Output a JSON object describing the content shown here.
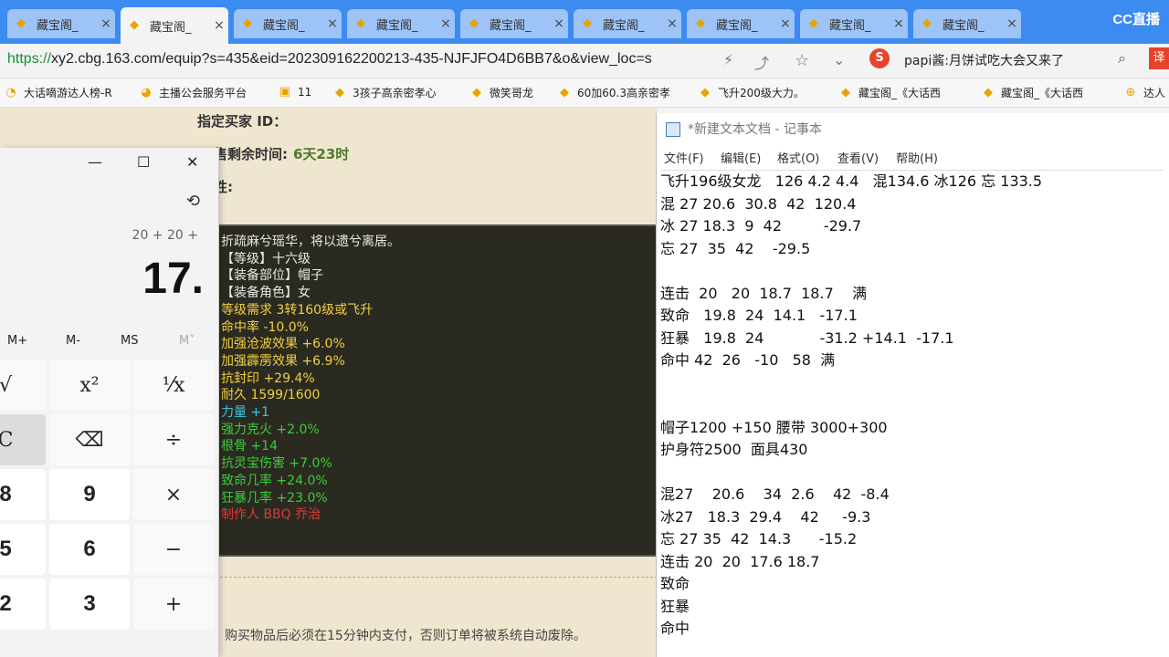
{
  "tabs": [
    {
      "label": "藏宝阁_"
    },
    {
      "label": "藏宝阁_"
    },
    {
      "label": "藏宝阁_"
    },
    {
      "label": "藏宝阁_"
    },
    {
      "label": "藏宝阁_"
    },
    {
      "label": "藏宝阁_"
    },
    {
      "label": "藏宝阁_"
    },
    {
      "label": "藏宝阁_"
    },
    {
      "label": "藏宝阁_"
    }
  ],
  "tab_close": "×",
  "cc_logo": "CC直播",
  "address": {
    "scheme": "https://",
    "rest": "xy2.cbg.163.com/equip?s=435&eid=202309162200213-435-NJFJFO4D6BB7&o&view_loc=s",
    "search_badge": "S",
    "search_text": "papi酱:月饼试吃大会又来了"
  },
  "bookmarks": [
    {
      "label": "大话嘀游达人榜-R"
    },
    {
      "label": "主播公会服务平台"
    },
    {
      "label": "11"
    },
    {
      "label": "3孩子高亲密孝心"
    },
    {
      "label": "微笑哥龙"
    },
    {
      "label": "60加60.3高亲密孝"
    },
    {
      "label": "飞升200级大力。"
    },
    {
      "label": "藏宝阁_《大话西"
    },
    {
      "label": "藏宝阁_《大话西"
    },
    {
      "label": "达人"
    }
  ],
  "page": {
    "buyer_id_label": "指定买家 ID：",
    "time_left_label": "售剩余时间:",
    "time_left_value": "6天23时",
    "other_label": "性:",
    "item_lines": [
      {
        "text": "折疏麻兮瑶华，将以遗兮离居。",
        "color": "#e8e8e8"
      },
      {
        "text": "【等级】十六级",
        "color": "#e8e8e8"
      },
      {
        "text": "【装备部位】帽子",
        "color": "#e8e8e8"
      },
      {
        "text": "【装备角色】女",
        "color": "#e8e8e8"
      },
      {
        "text": "等级需求 3转160级或飞升",
        "color": "#f0d040"
      },
      {
        "text": "命中率 -10.0%",
        "color": "#f0d040"
      },
      {
        "text": "加强沧波效果 +6.0%",
        "color": "#f0d040"
      },
      {
        "text": "加强霹雳效果 +6.9%",
        "color": "#f0d040"
      },
      {
        "text": "抗封印 +29.4%",
        "color": "#f0d040"
      },
      {
        "text": "耐久 1599/1600",
        "color": "#f0d040"
      },
      {
        "text": "力量 +1",
        "color": "#35c8e8"
      },
      {
        "text": "强力克火 +2.0%",
        "color": "#3ccc3c"
      },
      {
        "text": "根骨 +14",
        "color": "#3ccc3c"
      },
      {
        "text": "抗灵宝伤害 +7.0%",
        "color": "#3ccc3c"
      },
      {
        "text": "致命几率 +24.0%",
        "color": "#3ccc3c"
      },
      {
        "text": "狂暴几率 +23.0%",
        "color": "#3ccc3c"
      },
      {
        "text": "制作人 BBQ 乔治",
        "color": "#e03838"
      }
    ],
    "notice": "购买物品后必须在15分钟内支付，否则订单将被系统自动废除。"
  },
  "calculator": {
    "minimize": "—",
    "maximize": "☐",
    "close": "✕",
    "expression": "20 + 20 +",
    "display": "17.",
    "memory": [
      "M+",
      "M-",
      "MS",
      "M˅"
    ],
    "keys": [
      {
        "label": "√",
        "type": "op"
      },
      {
        "label": "x²",
        "type": "op"
      },
      {
        "label": "¹⁄x",
        "type": "op"
      },
      {
        "label": "C",
        "type": "sel"
      },
      {
        "label": "⌫",
        "type": "op"
      },
      {
        "label": "÷",
        "type": "op"
      },
      {
        "label": "8",
        "type": "num"
      },
      {
        "label": "9",
        "type": "num"
      },
      {
        "label": "×",
        "type": "op"
      },
      {
        "label": "5",
        "type": "num"
      },
      {
        "label": "6",
        "type": "num"
      },
      {
        "label": "−",
        "type": "op"
      },
      {
        "label": "2",
        "type": "num"
      },
      {
        "label": "3",
        "type": "num"
      },
      {
        "label": "+",
        "type": "op"
      }
    ]
  },
  "notepad": {
    "title": "*新建文本文档 - 记事本",
    "menu": [
      "文件(F)",
      "编辑(E)",
      "格式(O)",
      "查看(V)",
      "帮助(H)"
    ],
    "lines": [
      "飞升196级女龙   126 4.2 4.4   混134.6 冰126 忘 133.5",
      "混 27 20.6  30.8  42  120.4",
      "冰 27 18.3  9  42         -29.7",
      "忘 27  35  42    -29.5",
      "",
      "连击  20   20  18.7  18.7    满",
      "致命   19.8  24  14.1   -17.1",
      "狂暴   19.8  24            -31.2 +14.1  -17.1",
      "命中 42  26   -10   58  满",
      "",
      "",
      "帽子1200 +150 腰带 3000+300",
      "护身符2500  面具430",
      "",
      "混27    20.6    34  2.6    42  -8.4",
      "冰27   18.3  29.4    42     -9.3",
      "忘 27 35  42  14.3      -15.2",
      "连击 20  20  17.6 18.7",
      "致命",
      "狂暴",
      "命中"
    ]
  }
}
